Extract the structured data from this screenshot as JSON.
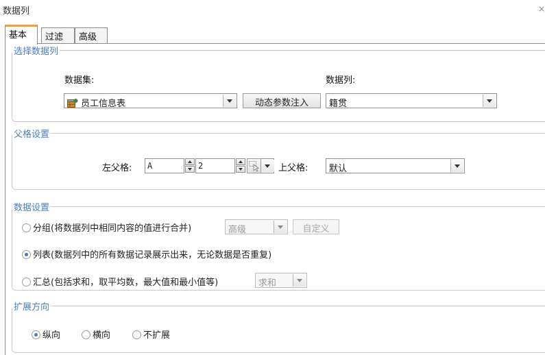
{
  "window": {
    "title": "数据列",
    "close_glyph": "×"
  },
  "tabs": [
    {
      "label": "基本",
      "active": true
    },
    {
      "label": "过滤",
      "active": false
    },
    {
      "label": "高级",
      "active": false
    }
  ],
  "select_column": {
    "legend": "选择数据列",
    "dataset_label": "数据集:",
    "dataset_value": "员工信息表",
    "dataset_icon": "table-icon",
    "dynamic_param_button": "动态参数注入",
    "column_label": "数据列:",
    "column_value": "籍贯"
  },
  "parent_settings": {
    "legend": "父格设置",
    "left_parent_label": "左父格:",
    "left_parent_col": "A",
    "left_parent_row": "2",
    "cell_picker_icon": "cell-picker-icon",
    "top_parent_label": "上父格:",
    "top_parent_value": "默认"
  },
  "data_settings": {
    "legend": "数据设置",
    "group_option": "分组(将数据列中相同内容的值进行合并)",
    "group_mode": "高级",
    "group_custom_button": "自定义",
    "list_option": "列表(数据列中的所有数据记录展示出来，无论数据是否重复)",
    "summary_option": "汇总(包括求和，取平均数，最大值和最小值等)",
    "summary_mode": "求和",
    "selected": "list"
  },
  "expand_direction": {
    "legend": "扩展方向",
    "options": [
      "纵向",
      "横向",
      "不扩展"
    ],
    "selected": "纵向"
  },
  "colors": {
    "legend": "#4a7fc1",
    "active_tab_accent": "#f0a030",
    "radio_dot": "#3e7ad1"
  }
}
